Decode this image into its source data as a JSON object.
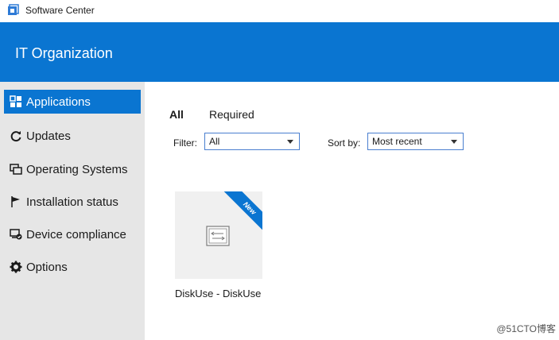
{
  "window": {
    "title": "Software Center",
    "icon": "software-center-icon"
  },
  "header": {
    "org_name": "IT Organization",
    "color": "#0a75d1"
  },
  "sidebar": {
    "items": [
      {
        "label": "Applications",
        "icon": "applications-grid-icon",
        "active": true
      },
      {
        "label": "Updates",
        "icon": "refresh-icon",
        "active": false
      },
      {
        "label": "Operating Systems",
        "icon": "windows-stack-icon",
        "active": false
      },
      {
        "label": "Installation status",
        "icon": "flag-icon",
        "active": false
      },
      {
        "label": "Device compliance",
        "icon": "device-compliance-icon",
        "active": false
      },
      {
        "label": "Options",
        "icon": "gear-icon",
        "active": false
      }
    ]
  },
  "main": {
    "tabs": [
      {
        "label": "All",
        "active": true
      },
      {
        "label": "Required",
        "active": false
      }
    ],
    "filter": {
      "label": "Filter:",
      "value": "All"
    },
    "sort": {
      "label": "Sort by:",
      "value": "Most recent"
    },
    "apps": [
      {
        "name": "DiskUse - DiskUse",
        "badge": "New",
        "icon": "generic-app-icon"
      }
    ]
  },
  "watermark": "@51CTO博客"
}
